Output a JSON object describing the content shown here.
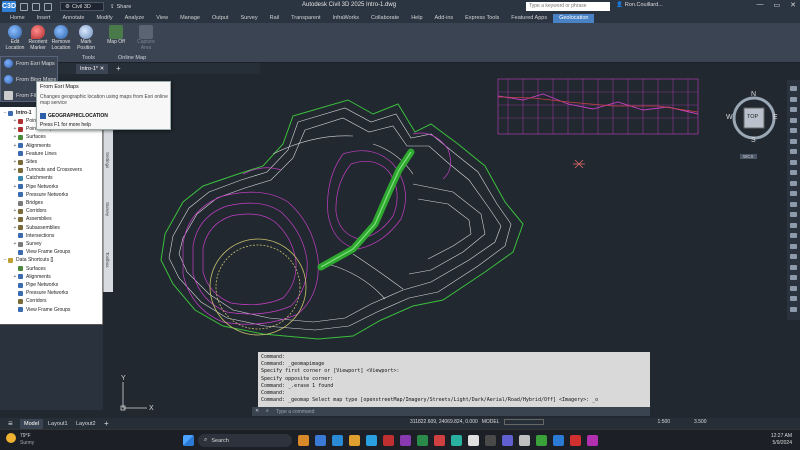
{
  "titlebar": {
    "logo_text": "C3D",
    "doc_selector": "Civil 3D",
    "share_label": "Share",
    "window_title": "Autodesk Civil 3D 2025   Intro-1.dwg",
    "search_placeholder": "Type a keyword or phrase",
    "user_name": "Ron.Couillard..."
  },
  "ribbon_tabs": [
    "Home",
    "Insert",
    "Annotate",
    "Modify",
    "Analyze",
    "View",
    "Manage",
    "Output",
    "Survey",
    "Rail",
    "Transparent",
    "InfraWorks",
    "Collaborate",
    "Help",
    "Add-ins",
    "Express Tools",
    "Featured Apps",
    "Geolocation"
  ],
  "ribbon_active_tab": "Geolocation",
  "ribbon_buttons": [
    {
      "label": "Edit Location"
    },
    {
      "label": "Reorient Marker"
    },
    {
      "label": "Remove Location"
    },
    {
      "label": "Mark Position"
    },
    {
      "label": "Map Off"
    },
    {
      "label": "Capture Area"
    }
  ],
  "ribbon_panels": {
    "tools": "Tools",
    "online_map": "Online Map"
  },
  "file_tabs": [
    "Intro-1*"
  ],
  "flyout": {
    "item1": "From Esri Maps",
    "item2": "From Bing Maps",
    "item3": "From File"
  },
  "tooltip": {
    "title": "From Esri Maps",
    "description": "Changes geographic location using maps from Esri online map service",
    "command": "GEOGRAPHICLOCATION",
    "help": "Press F1 for more help"
  },
  "prospector": {
    "root": "Intro-1",
    "items": [
      {
        "label": "Points",
        "level": 1,
        "exp": "+",
        "color": "#b03030"
      },
      {
        "label": "Point Groups",
        "level": 1,
        "exp": "+",
        "color": "#b03030"
      },
      {
        "label": "Surfaces",
        "level": 1,
        "exp": "+",
        "color": "#4a8a3a"
      },
      {
        "label": "Alignments",
        "level": 1,
        "exp": "+",
        "color": "#3a6ab0"
      },
      {
        "label": "Feature Lines",
        "level": 1,
        "exp": "",
        "color": "#3a6ab0"
      },
      {
        "label": "Sites",
        "level": 1,
        "exp": "+",
        "color": "#7a6a3a"
      },
      {
        "label": "Turnouts and Crossovers",
        "level": 1,
        "exp": "+",
        "color": "#7a6a3a"
      },
      {
        "label": "Catchments",
        "level": 1,
        "exp": "",
        "color": "#3a8ab0"
      },
      {
        "label": "Pipe Networks",
        "level": 1,
        "exp": "+",
        "color": "#3a6ab0"
      },
      {
        "label": "Pressure Networks",
        "level": 1,
        "exp": "",
        "color": "#3a6ab0"
      },
      {
        "label": "Bridges",
        "level": 1,
        "exp": "",
        "color": "#7a7a7a"
      },
      {
        "label": "Corridors",
        "level": 1,
        "exp": "+",
        "color": "#7a6a3a"
      },
      {
        "label": "Assemblies",
        "level": 1,
        "exp": "+",
        "color": "#7a6a3a"
      },
      {
        "label": "Subassemblies",
        "level": 1,
        "exp": "+",
        "color": "#7a6a3a"
      },
      {
        "label": "Intersections",
        "level": 1,
        "exp": "",
        "color": "#3a6ab0"
      },
      {
        "label": "Survey",
        "level": 1,
        "exp": "+",
        "color": "#7a7a7a"
      },
      {
        "label": "View Frame Groups",
        "level": 1,
        "exp": "",
        "color": "#3a6ab0"
      },
      {
        "label": "Data Shortcuts []",
        "level": 0,
        "exp": "-",
        "color": "#c0a030"
      },
      {
        "label": "Surfaces",
        "level": 1,
        "exp": "",
        "color": "#4a8a3a"
      },
      {
        "label": "Alignments",
        "level": 1,
        "exp": "+",
        "color": "#3a6ab0"
      },
      {
        "label": "Pipe Networks",
        "level": 1,
        "exp": "",
        "color": "#3a6ab0"
      },
      {
        "label": "Pressure Networks",
        "level": 1,
        "exp": "",
        "color": "#3a6ab0"
      },
      {
        "label": "Corridors",
        "level": 1,
        "exp": "",
        "color": "#7a6a3a"
      },
      {
        "label": "View Frame Groups",
        "level": 1,
        "exp": "",
        "color": "#3a6ab0"
      }
    ]
  },
  "side_tabs": [
    "Settings",
    "Survey",
    "Toolbox"
  ],
  "viewcube": {
    "top": "TOP",
    "n": "N",
    "s": "S",
    "e": "E",
    "w": "W",
    "wcs": "WCS"
  },
  "command_history": [
    "Command:",
    "Command:  _geomapimage",
    "Specify first corner or [Viewport] <Viewport>:",
    "Specify opposite corner:",
    "Command:  _.erase 1 found",
    "Command:",
    "Command:  _geomap Select map type [openstreetMap/Imagery/Streets/Light/Dark/Aerial/Road/Hybrid/Off] <Imagery>: _o"
  ],
  "command_placeholder": "Type a command",
  "layout_tabs": [
    "Model",
    "Layout1",
    "Layout2"
  ],
  "status": {
    "coords": "311822.609, 24069.824, 0.000",
    "model": "MODEL",
    "scale": "1:500",
    "elevation": "3.500"
  },
  "taskbar": {
    "weather_temp": "79°F",
    "weather_desc": "Sunny",
    "search_label": "Search",
    "time": "12:27 AM",
    "date": "5/9/2024"
  },
  "colors": {
    "contour_green": "#3cbf3c",
    "contour_magenta": "#c43fc4",
    "contour_white": "#d7d7d7",
    "contour_yellow": "#c8c06a",
    "accent_blue": "#4a83c5"
  }
}
